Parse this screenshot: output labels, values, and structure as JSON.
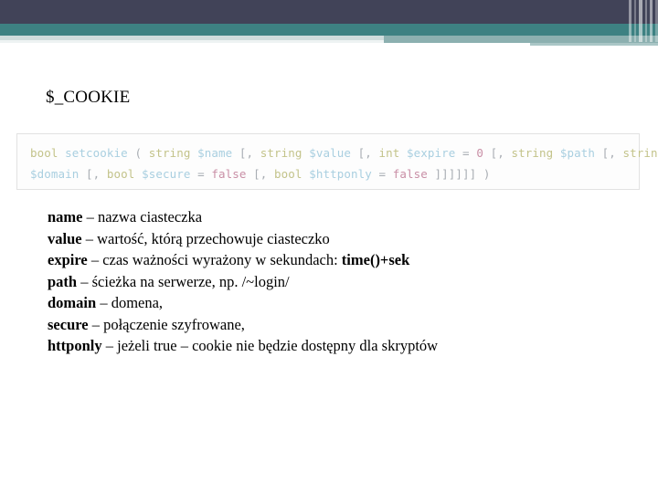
{
  "slide": {
    "title": "$_COOKIE",
    "theme": {
      "band_dark": "#414358",
      "band_teal": "#3d8182",
      "band_light_teal": "#8cb0b0",
      "band_pale": "#cfdcdc",
      "background": "#ffffff",
      "code_bg": "#fdfdfd",
      "code_border": "#e2e2e2"
    }
  },
  "code": {
    "line1": [
      {
        "text": "bool",
        "type": "type"
      },
      {
        "text": " ",
        "type": "punct"
      },
      {
        "text": "setcookie",
        "type": "func"
      },
      {
        "text": " ",
        "type": "punct"
      },
      {
        "text": "(",
        "type": "punct"
      },
      {
        "text": " ",
        "type": "punct"
      },
      {
        "text": "string",
        "type": "type"
      },
      {
        "text": " ",
        "type": "punct"
      },
      {
        "text": "$name",
        "type": "var"
      },
      {
        "text": " [, ",
        "type": "punct"
      },
      {
        "text": "string",
        "type": "type"
      },
      {
        "text": " ",
        "type": "punct"
      },
      {
        "text": "$value",
        "type": "var"
      },
      {
        "text": " [, ",
        "type": "punct"
      },
      {
        "text": "int",
        "type": "type"
      },
      {
        "text": " ",
        "type": "punct"
      },
      {
        "text": "$expire",
        "type": "var"
      },
      {
        "text": " ",
        "type": "punct"
      },
      {
        "text": "=",
        "type": "op"
      },
      {
        "text": " ",
        "type": "punct"
      },
      {
        "text": "0",
        "type": "num"
      },
      {
        "text": " [, ",
        "type": "punct"
      },
      {
        "text": "string",
        "type": "type"
      },
      {
        "text": " ",
        "type": "punct"
      },
      {
        "text": "$path",
        "type": "var"
      },
      {
        "text": " [, ",
        "type": "punct"
      },
      {
        "text": "string",
        "type": "type"
      }
    ],
    "line2": [
      {
        "text": "$domain",
        "type": "var"
      },
      {
        "text": " [, ",
        "type": "punct"
      },
      {
        "text": "bool",
        "type": "type"
      },
      {
        "text": " ",
        "type": "punct"
      },
      {
        "text": "$secure",
        "type": "var"
      },
      {
        "text": " ",
        "type": "punct"
      },
      {
        "text": "=",
        "type": "op"
      },
      {
        "text": " ",
        "type": "punct"
      },
      {
        "text": "false",
        "type": "bool"
      },
      {
        "text": " [, ",
        "type": "punct"
      },
      {
        "text": "bool",
        "type": "type"
      },
      {
        "text": " ",
        "type": "punct"
      },
      {
        "text": "$httponly",
        "type": "var"
      },
      {
        "text": " ",
        "type": "punct"
      },
      {
        "text": "=",
        "type": "op"
      },
      {
        "text": " ",
        "type": "punct"
      },
      {
        "text": "false",
        "type": "bool"
      },
      {
        "text": " ]]]]]] )",
        "type": "punct"
      }
    ],
    "plain_text": "bool setcookie ( string $name [, string $value [, int $expire = 0 [, string $path [, string $domain [, bool $secure = false [, bool $httponly = false ]]]]]] )"
  },
  "params": [
    {
      "name": "name",
      "separator": " – ",
      "desc": "nazwa ciasteczka",
      "desc_bold": ""
    },
    {
      "name": "value",
      "separator": " – ",
      "desc": "wartość, którą przechowuje ciasteczko",
      "desc_bold": ""
    },
    {
      "name": "expire",
      "separator": " – ",
      "desc": "czas ważności wyrażony w sekundach: ",
      "desc_bold": "time()+sek"
    },
    {
      "name": "path",
      "separator": " – ",
      "desc": "ścieżka na serwerze, np. /~login/",
      "desc_bold": ""
    },
    {
      "name": "domain",
      "separator": " – ",
      "desc": "domena,",
      "desc_bold": ""
    },
    {
      "name": "secure",
      "separator": " – ",
      "desc": "połączenie szyfrowane,",
      "desc_bold": ""
    },
    {
      "name": "httponly",
      "separator": " – ",
      "desc": "jeżeli true – cookie nie będzie dostępny dla skryptów",
      "desc_bold": ""
    }
  ]
}
